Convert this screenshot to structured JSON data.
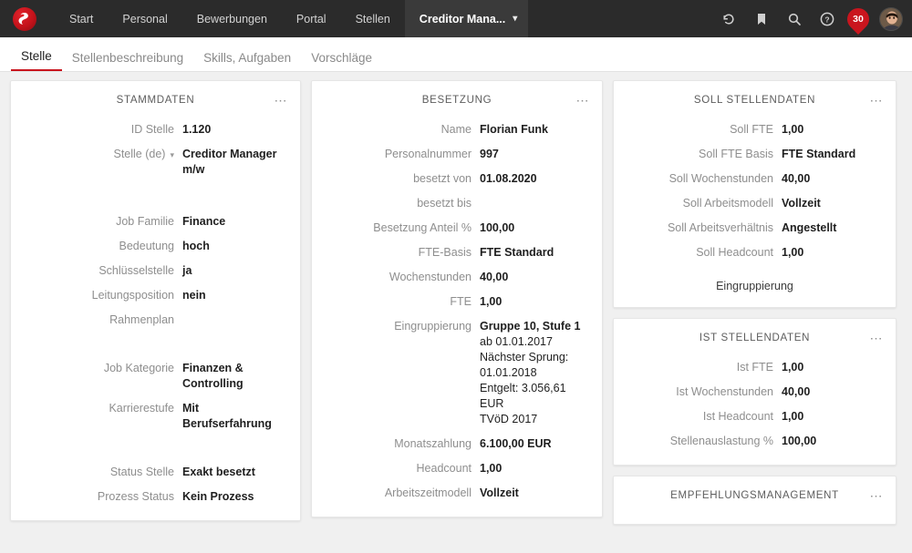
{
  "topbar": {
    "logo_name": "rexx-systems-logo",
    "nav": [
      {
        "label": "Start",
        "active": false
      },
      {
        "label": "Personal",
        "active": false
      },
      {
        "label": "Bewerbungen",
        "active": false
      },
      {
        "label": "Portal",
        "active": false
      },
      {
        "label": "Stellen",
        "active": false
      },
      {
        "label": "Creditor Mana...",
        "active": true
      }
    ],
    "icons": [
      {
        "name": "history-icon",
        "glyph": "↺"
      },
      {
        "name": "bookmark-icon",
        "glyph": "⚑"
      },
      {
        "name": "search-icon",
        "glyph": "⚲"
      },
      {
        "name": "help-icon",
        "glyph": "?"
      }
    ],
    "notification_count": "30",
    "accent_color": "#c9151e",
    "bar_color": "#2b2b2b"
  },
  "tabs": [
    {
      "label": "Stelle",
      "active": true
    },
    {
      "label": "Stellenbeschreibung",
      "active": false
    },
    {
      "label": "Skills, Aufgaben",
      "active": false
    },
    {
      "label": "Vorschläge",
      "active": false
    }
  ],
  "cards": {
    "stammdaten": {
      "title": "STAMMDATEN",
      "rows": [
        {
          "label": "ID Stelle",
          "value": "1.120"
        },
        {
          "label": "Stelle (de)",
          "value": "Creditor Manager m/w",
          "dropdown": true
        },
        {
          "label": "Job Familie",
          "value": "Finance"
        },
        {
          "label": "Bedeutung",
          "value": "hoch"
        },
        {
          "label": "Schlüsselstelle",
          "value": "ja"
        },
        {
          "label": "Leitungsposition",
          "value": "nein"
        },
        {
          "label": "Rahmenplan",
          "value": ""
        },
        {
          "label": "Job Kategorie",
          "value": "Finanzen & Controlling"
        },
        {
          "label": "Karrierestufe",
          "value": "Mit Berufserfahrung"
        },
        {
          "label": "Status Stelle",
          "value": "Exakt besetzt"
        },
        {
          "label": "Prozess Status",
          "value": "Kein Prozess"
        }
      ]
    },
    "besetzung": {
      "title": "BESETZUNG",
      "rows": [
        {
          "label": "Name",
          "value": "Florian Funk"
        },
        {
          "label": "Personalnummer",
          "value": "997"
        },
        {
          "label": "besetzt von",
          "value": "01.08.2020"
        },
        {
          "label": "besetzt bis",
          "value": ""
        },
        {
          "label": "Besetzung Anteil %",
          "value": "100,00"
        },
        {
          "label": "FTE-Basis",
          "value": "FTE Standard"
        },
        {
          "label": "Wochenstunden",
          "value": "40,00"
        },
        {
          "label": "FTE",
          "value": "1,00"
        }
      ],
      "eingruppierung": {
        "label": "Eingruppierung",
        "value": "Gruppe 10, Stufe 1",
        "lines": [
          "ab 01.01.2017",
          "Nächster Sprung:",
          "01.01.2018",
          "Entgelt: 3.056,61 EUR",
          "TVöD 2017"
        ]
      },
      "rows_after": [
        {
          "label": "Monatszahlung",
          "value": "6.100,00 EUR"
        },
        {
          "label": "Headcount",
          "value": "1,00"
        },
        {
          "label": "Arbeitszeitmodell",
          "value": "Vollzeit"
        }
      ]
    },
    "soll_stellendaten": {
      "title": "SOLL STELLENDATEN",
      "rows": [
        {
          "label": "Soll FTE",
          "value": "1,00"
        },
        {
          "label": "Soll FTE Basis",
          "value": "FTE Standard"
        },
        {
          "label": "Soll Wochenstunden",
          "value": "40,00"
        },
        {
          "label": "Soll Arbeitsmodell",
          "value": "Vollzeit"
        },
        {
          "label": "Soll Arbeitsverhältnis",
          "value": "Angestellt"
        },
        {
          "label": "Soll Headcount",
          "value": "1,00"
        }
      ],
      "footer_link": "Eingruppierung"
    },
    "ist_stellendaten": {
      "title": "IST STELLENDATEN",
      "rows": [
        {
          "label": "Ist FTE",
          "value": "1,00"
        },
        {
          "label": "Ist Wochenstunden",
          "value": "40,00"
        },
        {
          "label": "Ist Headcount",
          "value": "1,00"
        },
        {
          "label": "Stellenauslastung %",
          "value": "100,00"
        }
      ]
    },
    "empfehlungsmanagement": {
      "title": "EMPFEHLUNGSMANAGEMENT"
    }
  }
}
